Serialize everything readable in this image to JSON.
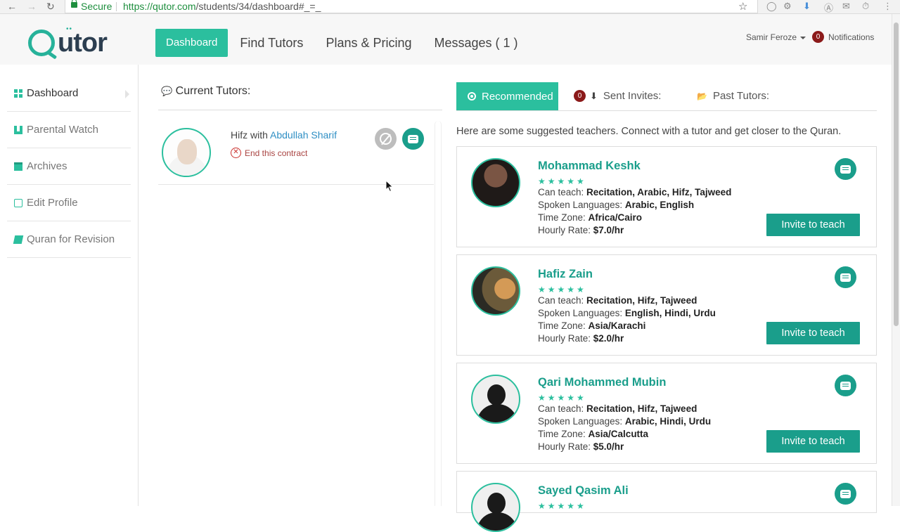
{
  "browser": {
    "secure_label": "Secure",
    "url_host": "https://qutor.com",
    "url_path": "/students/34/dashboard#_=_"
  },
  "header": {
    "logo_text": "Qutor",
    "nav": [
      "Dashboard",
      "Find Tutors",
      "Plans & Pricing",
      "Messages ( 1 )"
    ],
    "user_name": "Samir Feroze",
    "notifications_count": "0",
    "notifications_label": "Notifications"
  },
  "sidebar": {
    "items": [
      {
        "label": "Dashboard",
        "icon": "grid-icon"
      },
      {
        "label": "Parental Watch",
        "icon": "binoculars-icon"
      },
      {
        "label": "Archives",
        "icon": "archive-icon"
      },
      {
        "label": "Edit Profile",
        "icon": "edit-icon"
      },
      {
        "label": "Quran for Revision",
        "icon": "book-icon"
      }
    ]
  },
  "current_tutors": {
    "heading": "Current Tutors:",
    "tutor": {
      "subject_prefix": "Hifz with ",
      "name": "Abdullah Sharif",
      "end_contract": "End this contract"
    }
  },
  "tabs": {
    "recommended": "Recommended",
    "sent_count": "0",
    "sent": "Sent Invites:",
    "past": "Past Tutors:"
  },
  "suggest_text": "Here are some suggested teachers. Connect with a tutor and get closer to the Quran.",
  "labels": {
    "can_teach": "Can teach: ",
    "spoken": "Spoken Languages: ",
    "timezone": "Time Zone: ",
    "rate": "Hourly Rate: ",
    "invite": "Invite to teach",
    "stars": "★★★★★"
  },
  "teachers": [
    {
      "name": "Mohammad Keshk",
      "can_teach": "Recitation, Arabic, Hifz, Tajweed",
      "spoken": "Arabic, English",
      "timezone": "Africa/Cairo",
      "rate": "$7.0/hr"
    },
    {
      "name": "Hafiz Zain",
      "can_teach": "Recitation, Hifz, Tajweed",
      "spoken": "English, Hindi, Urdu",
      "timezone": "Asia/Karachi",
      "rate": "$2.0/hr"
    },
    {
      "name": "Qari Mohammed Mubin",
      "can_teach": "Recitation, Hifz, Tajweed",
      "spoken": "Arabic, Hindi, Urdu",
      "timezone": "Asia/Calcutta",
      "rate": "$5.0/hr"
    },
    {
      "name": "Sayed Qasim Ali"
    }
  ],
  "colors": {
    "accent": "#2bbf9e",
    "accent_dark": "#1a9e8b",
    "badge": "#8b1a1a",
    "link": "#2f8fc4"
  }
}
